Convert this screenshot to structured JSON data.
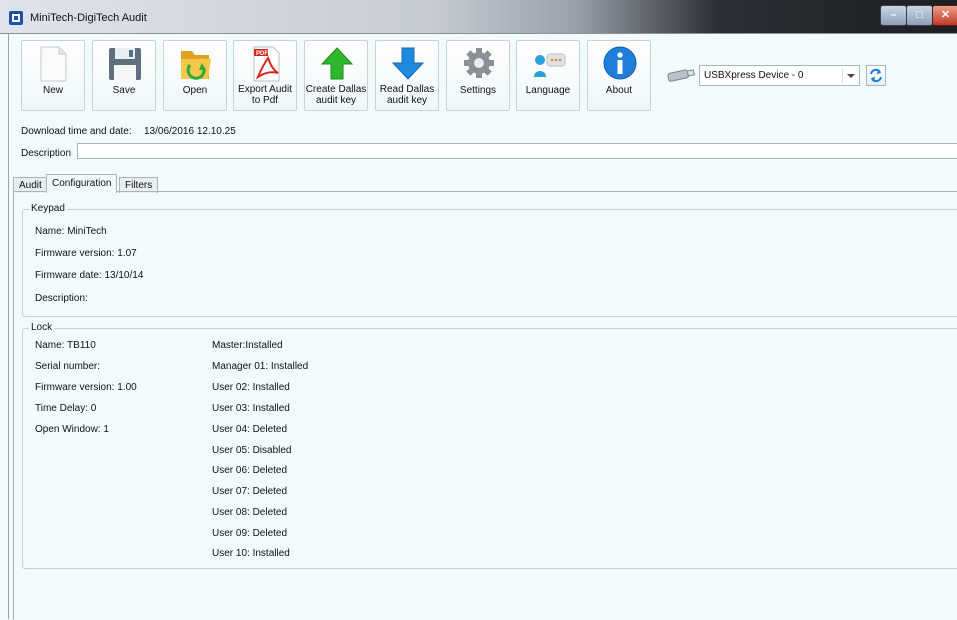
{
  "window": {
    "title": "MiniTech-DigiTech Audit"
  },
  "toolbar": {
    "buttons": [
      {
        "label": "New",
        "icon": "new-document-icon"
      },
      {
        "label": "Save",
        "icon": "floppy-disk-icon"
      },
      {
        "label": "Open",
        "icon": "open-folder-icon"
      },
      {
        "label": "Export Audit to Pdf",
        "line1": "Export Audit",
        "line2": "to Pdf",
        "icon": "pdf-icon"
      },
      {
        "label": "Create Dallas audit key",
        "line1": "Create Dallas",
        "line2": "audit key",
        "icon": "green-up-arrow-icon"
      },
      {
        "label": "Read Dallas audit key",
        "line1": "Read Dallas",
        "line2": "audit key",
        "icon": "blue-down-arrow-icon"
      },
      {
        "label": "Settings",
        "icon": "gear-icon"
      },
      {
        "label": "Language",
        "icon": "speech-bubble-icon"
      },
      {
        "label": "About",
        "icon": "info-icon"
      }
    ],
    "device": {
      "selected": "USBXpress Device - 0",
      "icon": "usb-stick-icon"
    },
    "refresh_icon": "refresh-icon"
  },
  "download": {
    "label": "Download time and date:",
    "value": "13/06/2016 12.10.25"
  },
  "description": {
    "label": "Description",
    "value": ""
  },
  "tabs": [
    {
      "label": "Audit",
      "active": false
    },
    {
      "label": "Configuration",
      "active": true
    },
    {
      "label": "Filters",
      "active": false
    }
  ],
  "keypad": {
    "title": "Keypad",
    "fields": [
      "Name:  MiniTech",
      "Firmware version:  1.07",
      "Firmware date:  13/10/14",
      "Description:"
    ]
  },
  "lock": {
    "title": "Lock",
    "fields": [
      "Name:  TB110",
      "Serial number:",
      "Firmware version:  1.00",
      "Time Delay:  0",
      "Open Window:  1"
    ],
    "users": [
      "Master:Installed",
      "Manager 01:  Installed",
      "User 02:  Installed",
      "User 03:  Installed",
      "User 04:  Deleted",
      "User 05:  Disabled",
      "User 06:  Deleted",
      "User 07:  Deleted",
      "User 08:  Deleted",
      "User 09:  Deleted",
      "User 10:  Installed"
    ]
  },
  "colors": {
    "background": "#f2fbfc",
    "accent_green": "#2eb82e",
    "accent_blue": "#1e8be0"
  }
}
